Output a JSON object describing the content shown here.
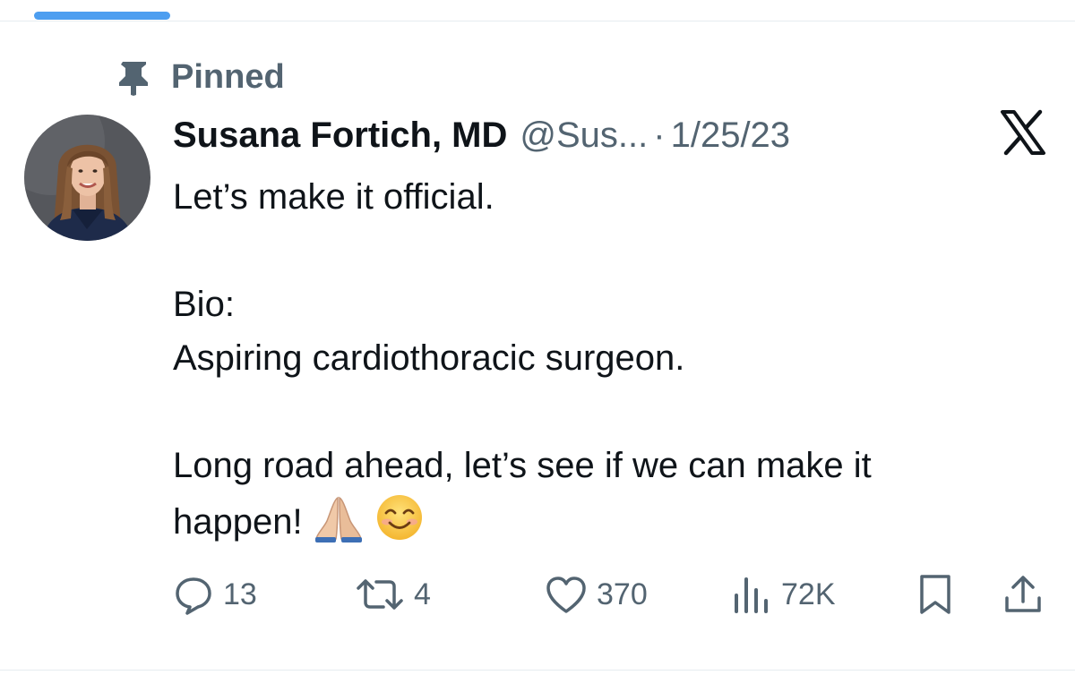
{
  "tweet": {
    "pinned_label": "Pinned",
    "author_name": "Susana Fortich, MD",
    "handle": "@Sus...",
    "separator": "·",
    "date": "1/25/23",
    "body": {
      "line1": "Let’s make it official.",
      "line2": "Bio:",
      "line3": "Aspiring cardiothoracic surgeon.",
      "line4": "Long road ahead, let’s see if we can make it",
      "line5": "happen!"
    },
    "emojis": [
      "folded-hands-icon",
      "smiling-face-icon"
    ]
  },
  "actions": {
    "replies": "13",
    "reposts": "4",
    "likes": "370",
    "views": "72K"
  },
  "colors": {
    "accent": "#4d9ef0",
    "secondary_text": "#536471",
    "primary_text": "#0f1419"
  }
}
